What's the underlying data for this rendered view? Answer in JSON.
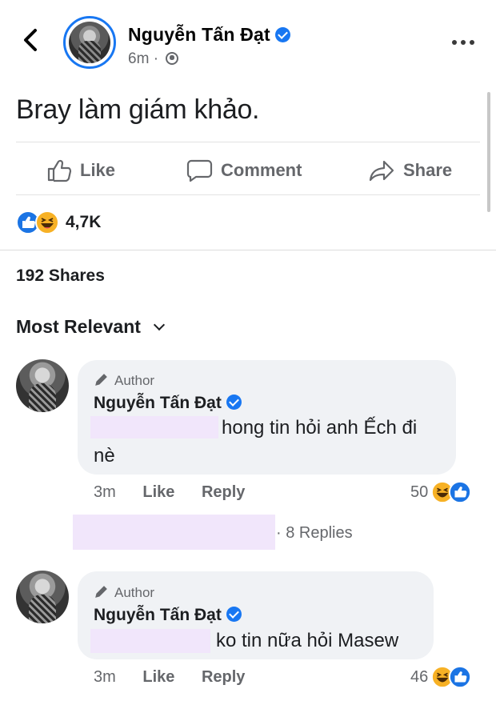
{
  "header": {
    "author_name": "Nguyễn Tấn Đạt",
    "time": "6m",
    "separator": "·"
  },
  "post": {
    "text": "Bray làm giám khảo."
  },
  "actions": {
    "like": "Like",
    "comment": "Comment",
    "share": "Share"
  },
  "reactions": {
    "count": "4,7K"
  },
  "shares": {
    "label": "192 Shares"
  },
  "sort": {
    "label": "Most Relevant"
  },
  "comments": [
    {
      "badge": "Author",
      "name": "Nguyễn Tấn Đạt",
      "text_line1": "hong tin hỏi anh Ếch đi",
      "text_line2": "nè",
      "time": "3m",
      "like": "Like",
      "reply": "Reply",
      "reaction_count": "50",
      "replies": "· 8 Replies"
    },
    {
      "badge": "Author",
      "name": "Nguyễn Tấn Đạt",
      "text_line1": "ko tin nữa hỏi Masew",
      "time": "3m",
      "like": "Like",
      "reply": "Reply",
      "reaction_count": "46"
    }
  ],
  "icons": {
    "back": "back-arrow-icon",
    "verified": "verified-badge-icon",
    "privacy": "globe-icon",
    "more": "more-options-icon",
    "like": "thumbs-up-icon",
    "comment": "comment-bubble-icon",
    "share": "share-arrow-icon",
    "reaction_like": "like-reaction-icon",
    "reaction_haha": "haha-reaction-icon",
    "author": "pencil-icon",
    "sort": "chevron-down-icon"
  },
  "colors": {
    "accent": "#1877f2",
    "text_secondary": "#65676b",
    "bubble": "#f0f2f5",
    "redaction": "#f1e6fb"
  }
}
